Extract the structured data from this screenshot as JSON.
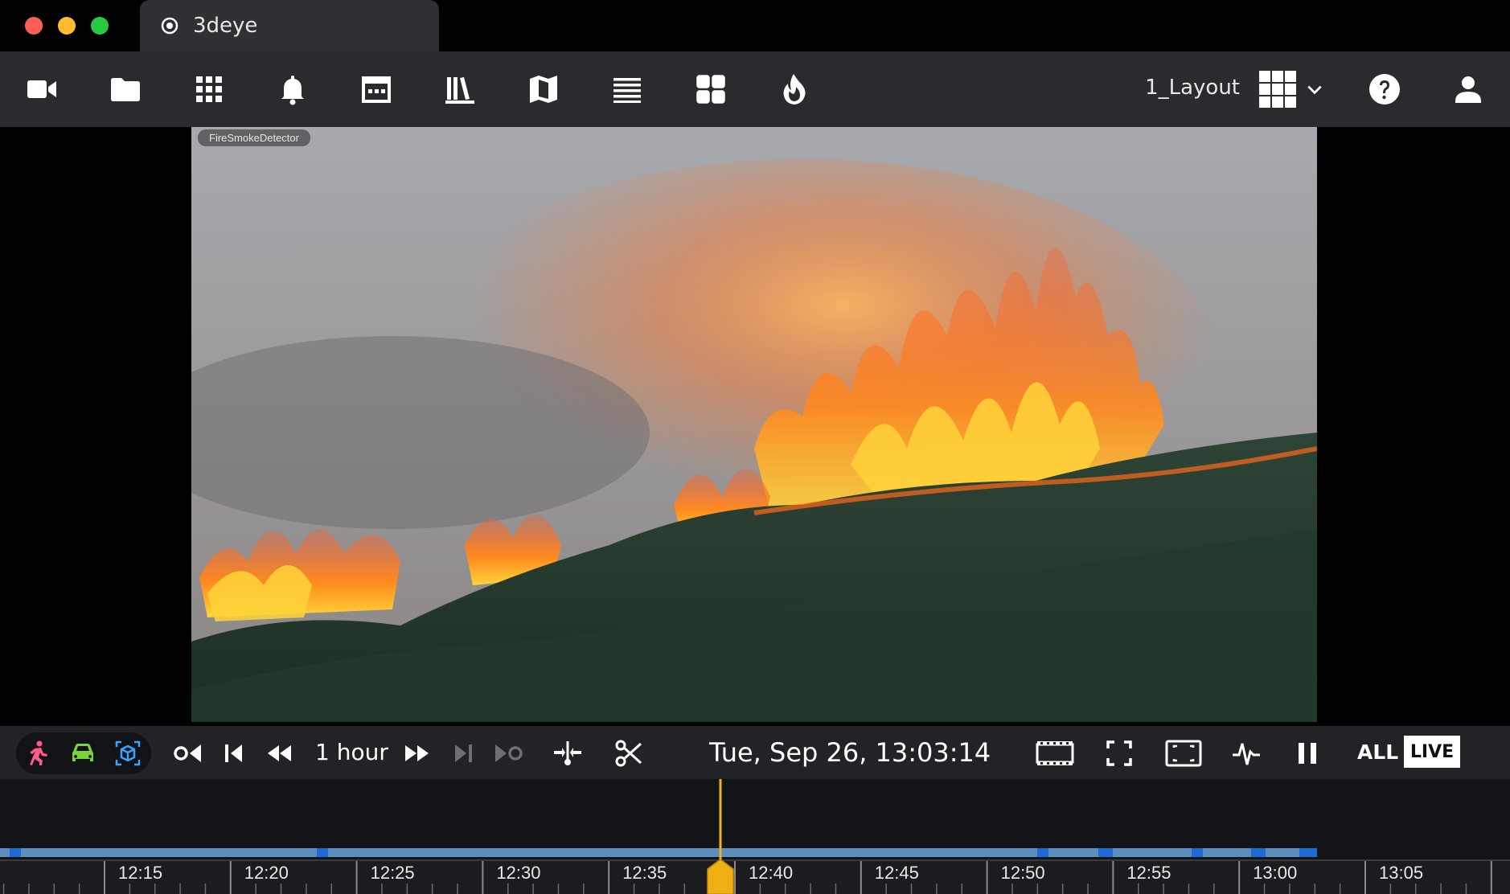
{
  "window": {
    "tab_title": "3deye",
    "traffic_colors": [
      "#fe5f57",
      "#febc2e",
      "#28c840"
    ]
  },
  "toolbar": {
    "icons": [
      "camera-icon",
      "folder-icon",
      "apps-grid-icon",
      "bell-icon",
      "calendar-icon",
      "library-icon",
      "map-icon",
      "list-icon",
      "dashboard-icon",
      "fire-icon"
    ],
    "layout_name": "1_Layout",
    "right_icons": [
      "help-icon",
      "user-icon"
    ]
  },
  "video": {
    "camera_label": "FireSmokeDetector"
  },
  "controls": {
    "object_filters": [
      {
        "name": "person-filter-icon",
        "color": "#ff5a8a"
      },
      {
        "name": "vehicle-filter-icon",
        "color": "#7bd23f"
      },
      {
        "name": "object-filter-icon",
        "color": "#3aa2ff"
      }
    ],
    "range_label": "1 hour",
    "datetime": "Tue, Sep 26, 13:03:14",
    "all_label": "ALL",
    "live_label": "LIVE"
  },
  "timeline": {
    "tick_labels": [
      "12:15",
      "12:20",
      "12:25",
      "12:30",
      "12:35",
      "12:40",
      "12:45",
      "12:50",
      "12:55",
      "13:00",
      "13:05"
    ],
    "colors": {
      "recording": "#5b8fbf",
      "event": "#1e6bd6",
      "cursor": "#f0b015"
    }
  }
}
